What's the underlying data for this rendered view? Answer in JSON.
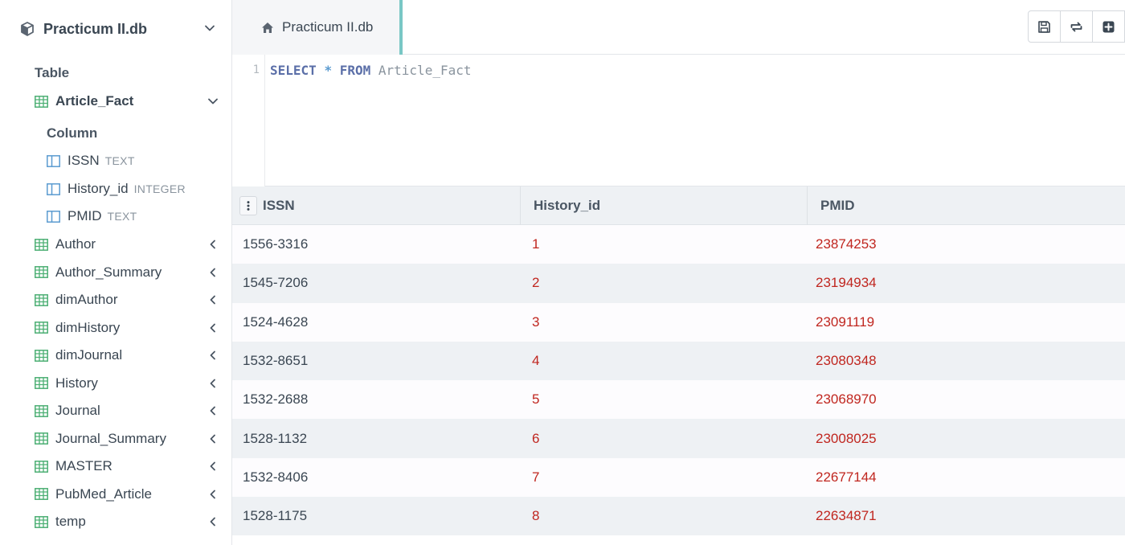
{
  "sidebar": {
    "db_name": "Practicum II.db",
    "table_section_label": "Table",
    "expanded_table": {
      "name": "Article_Fact",
      "column_section_label": "Column",
      "columns": [
        {
          "name": "ISSN",
          "type": "TEXT"
        },
        {
          "name": "History_id",
          "type": "INTEGER"
        },
        {
          "name": "PMID",
          "type": "TEXT"
        }
      ]
    },
    "tables": [
      {
        "name": "Author"
      },
      {
        "name": "Author_Summary"
      },
      {
        "name": "dimAuthor"
      },
      {
        "name": "dimHistory"
      },
      {
        "name": "dimJournal"
      },
      {
        "name": "History"
      },
      {
        "name": "Journal"
      },
      {
        "name": "Journal_Summary"
      },
      {
        "name": "MASTER"
      },
      {
        "name": "PubMed_Article"
      },
      {
        "name": "temp"
      }
    ]
  },
  "tab": {
    "label": "Practicum II.db"
  },
  "editor": {
    "line_number": "1",
    "kw_select": "SELECT",
    "star": "*",
    "kw_from": "FROM",
    "table": "Article_Fact"
  },
  "results": {
    "columns": [
      "ISSN",
      "History_id",
      "PMID"
    ],
    "rows": [
      [
        "1556-3316",
        "1",
        "23874253"
      ],
      [
        "1545-7206",
        "2",
        "23194934"
      ],
      [
        "1524-4628",
        "3",
        "23091119"
      ],
      [
        "1532-8651",
        "4",
        "23080348"
      ],
      [
        "1532-2688",
        "5",
        "23068970"
      ],
      [
        "1528-1132",
        "6",
        "23008025"
      ],
      [
        "1532-8406",
        "7",
        "22677144"
      ],
      [
        "1528-1175",
        "8",
        "22634871"
      ]
    ]
  },
  "colors": {
    "accent_tab": "#79c7c5",
    "table_icon": "#4caf73",
    "column_icon": "#5b9bd0",
    "numeric_text": "#c0261f"
  }
}
